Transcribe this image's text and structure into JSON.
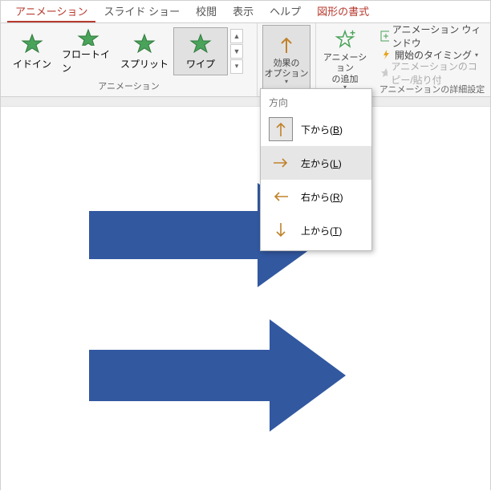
{
  "tabs": {
    "animation": "アニメーション",
    "slideshow": "スライド ショー",
    "review": "校閲",
    "view": "表示",
    "help": "ヘルプ",
    "format": "図形の書式"
  },
  "gallery": {
    "item0": "イドイン",
    "item1": "フロートイン",
    "item2": "スプリット",
    "item3": "ワイプ"
  },
  "ribbon": {
    "effect_options": "効果の\nオプション",
    "add_animation": "アニメーション\nの追加",
    "pane": "アニメーション ウィンドウ",
    "trigger": "開始のタイミング",
    "painter": "アニメーションのコピー/貼り付",
    "group_anim": "アニメーション",
    "group_adv": "アニメーションの詳細設定"
  },
  "menu": {
    "header": "方向",
    "from_bottom": "下から(",
    "from_bottom_k": "B",
    "from_left": "左から(",
    "from_left_k": "L",
    "from_right": "右から(",
    "from_right_k": "R",
    "from_top": "上から(",
    "from_top_k": "T",
    "close_paren": ")"
  }
}
